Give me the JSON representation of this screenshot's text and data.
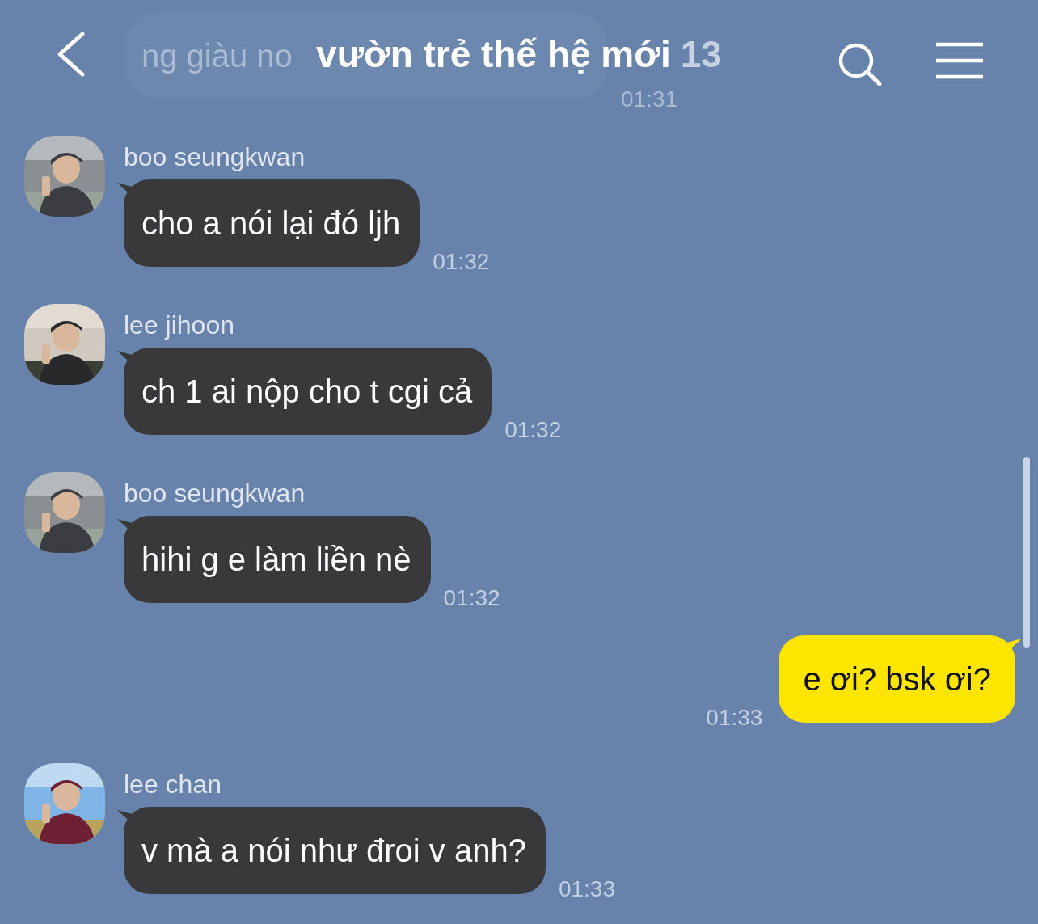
{
  "header": {
    "title": "vườn trẻ thế hệ mới",
    "member_count": "13"
  },
  "messages": [
    {
      "kind": "faded",
      "text": "ng giàu no",
      "time": "01:31"
    },
    {
      "kind": "received",
      "sender": "boo seungkwan",
      "text": "cho a nói lại đó ljh",
      "time": "01:32"
    },
    {
      "kind": "received",
      "sender": "lee jihoon",
      "text": "ch 1 ai nộp cho t cgi cả",
      "time": "01:32"
    },
    {
      "kind": "received",
      "sender": "boo seungkwan",
      "text": "hihi g e làm liền nè",
      "time": "01:32"
    },
    {
      "kind": "sent",
      "text": "e ơi? bsk ơi?",
      "time": "01:33"
    },
    {
      "kind": "received",
      "sender": "lee chan",
      "text": "v mà a nói như đroi v anh?",
      "time": "01:33"
    }
  ]
}
